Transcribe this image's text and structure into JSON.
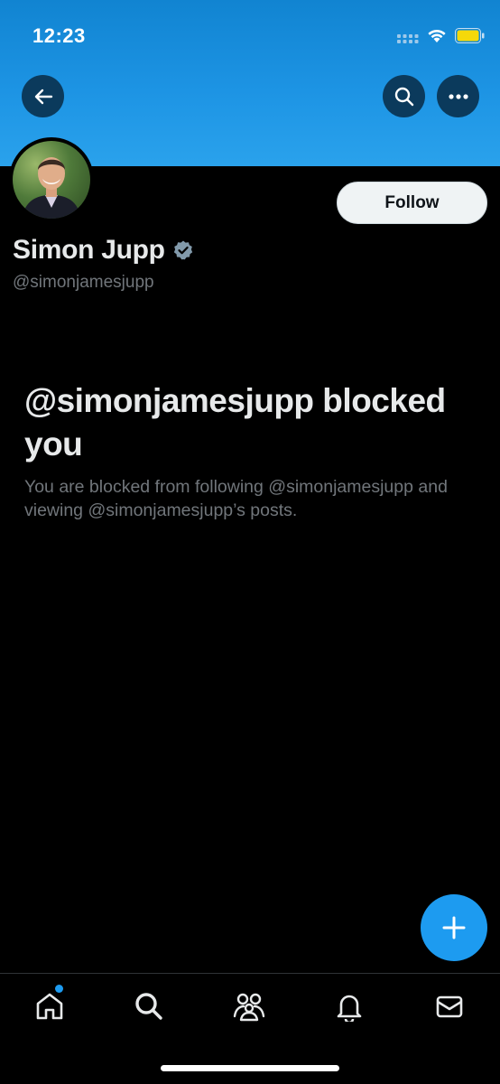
{
  "status_bar": {
    "time": "12:23",
    "icons": [
      "cellular-signal-icon",
      "wifi-icon",
      "battery-icon"
    ],
    "battery_color": "#f5d90a"
  },
  "header": {
    "back_icon": "arrow-left-icon",
    "search_icon": "search-icon",
    "more_icon": "ellipsis-icon",
    "banner_color": "#1d94e4"
  },
  "profile": {
    "display_name": "Simon Jupp",
    "handle": "@simonjamesjupp",
    "verified_icon": "verified-badge-icon",
    "verified_color": "#829aab",
    "follow_label": "Follow"
  },
  "blocked": {
    "title": "@simonjamesjupp blocked you",
    "description": "You are blocked from following @simonjamesjupp and viewing @simonjamesjupp’s posts."
  },
  "compose": {
    "icon": "plus-icon",
    "color": "#1d9bf0"
  },
  "tab_bar": {
    "tabs": [
      {
        "name": "home",
        "icon": "home-icon",
        "has_notification_dot": true
      },
      {
        "name": "search",
        "icon": "search-icon"
      },
      {
        "name": "communities",
        "icon": "communities-icon"
      },
      {
        "name": "notifications",
        "icon": "bell-icon"
      },
      {
        "name": "messages",
        "icon": "envelope-icon"
      }
    ]
  }
}
